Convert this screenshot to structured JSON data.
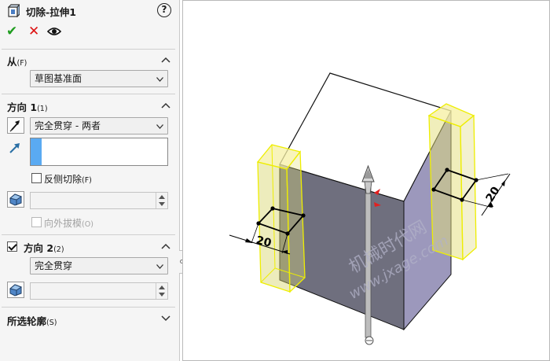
{
  "feature": {
    "title": "切除-拉伸1",
    "help": "?",
    "icon": "extruded-cut-icon"
  },
  "actions": {
    "ok": "✔",
    "cancel": "✕",
    "preview": "eye-icon"
  },
  "from": {
    "label": "从",
    "suffix": "(F)",
    "value": "草图基准面"
  },
  "direction1": {
    "label": "方向 1",
    "suffix": "(1)",
    "end_condition": "完全贯穿 - 两者",
    "flip_side_label": "反侧切除",
    "flip_side_suffix": "(F)",
    "flip_side_checked": false,
    "draft_outward_label": "向外拔模",
    "draft_outward_suffix": "(O)"
  },
  "direction2": {
    "label": "方向 2",
    "suffix": "(2)",
    "checked": true,
    "end_condition": "完全贯穿"
  },
  "selected_contours": {
    "label": "所选轮廓",
    "suffix": "(S)"
  },
  "viewport": {
    "dimension_left": "20",
    "dimension_right": "20",
    "watermark_line1": "机械时代网",
    "watermark_line2": "www.jxage.com"
  },
  "colors": {
    "accent": "#5aaaf2",
    "ok": "#1f9d1f",
    "cancel": "#dd1111",
    "preview_outline": "#f2f200"
  }
}
